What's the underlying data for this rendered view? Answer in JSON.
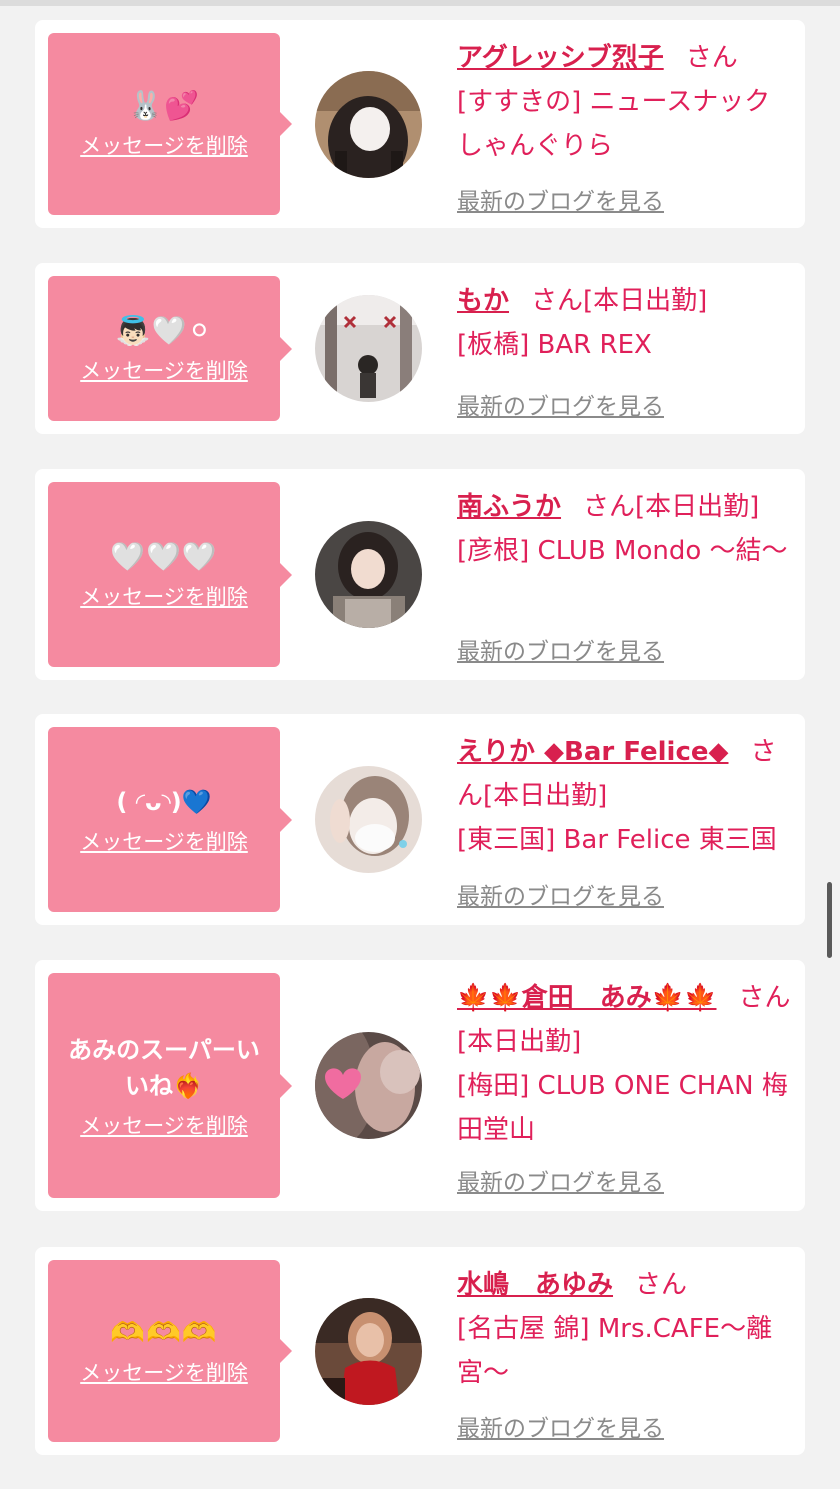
{
  "delete_label": "メッセージを削除",
  "blog_label": "最新のブログを見る",
  "san": "さん",
  "colors": {
    "bubble": "#f58aa0",
    "accent": "#d8204e",
    "link_gray": "#8a8a8a"
  },
  "cards": [
    {
      "message": "🐰💕",
      "name": "アグレッシブ烈子",
      "tag": "",
      "store": "[すすきの] ニュースナック しゃんぐりら",
      "avatar_icon": "girl-photo"
    },
    {
      "message": "👼🏻🤍⚪",
      "name": "もか",
      "tag": "[本日出勤]",
      "store": "[板橋] BAR REX",
      "avatar_icon": "girl-photo"
    },
    {
      "message": "🤍🤍🤍",
      "name": "南ふうか",
      "tag": "[本日出勤]",
      "store": "[彦根] CLUB Mondo 〜結〜",
      "avatar_icon": "girl-photo"
    },
    {
      "message": "( ◜ᴗ◝)💙",
      "name": "えりか ◆Bar Felice◆",
      "tag": "[本日出勤]",
      "store": "[東三国] Bar Felice 東三国",
      "avatar_icon": "girl-photo"
    },
    {
      "message": "あみのスーパーいいね❤️‍🔥",
      "name": "🍁🍁倉田　あみ🍁🍁",
      "tag": "[本日出勤]",
      "store": "[梅田] CLUB ONE CHAN 梅田堂山",
      "avatar_icon": "girl-photo"
    },
    {
      "message": "🫶🫶🫶",
      "name": "水嶋　あゆみ",
      "tag": "",
      "store": "[名古屋 錦] Mrs.CAFE〜離宮〜",
      "avatar_icon": "girl-photo"
    }
  ]
}
